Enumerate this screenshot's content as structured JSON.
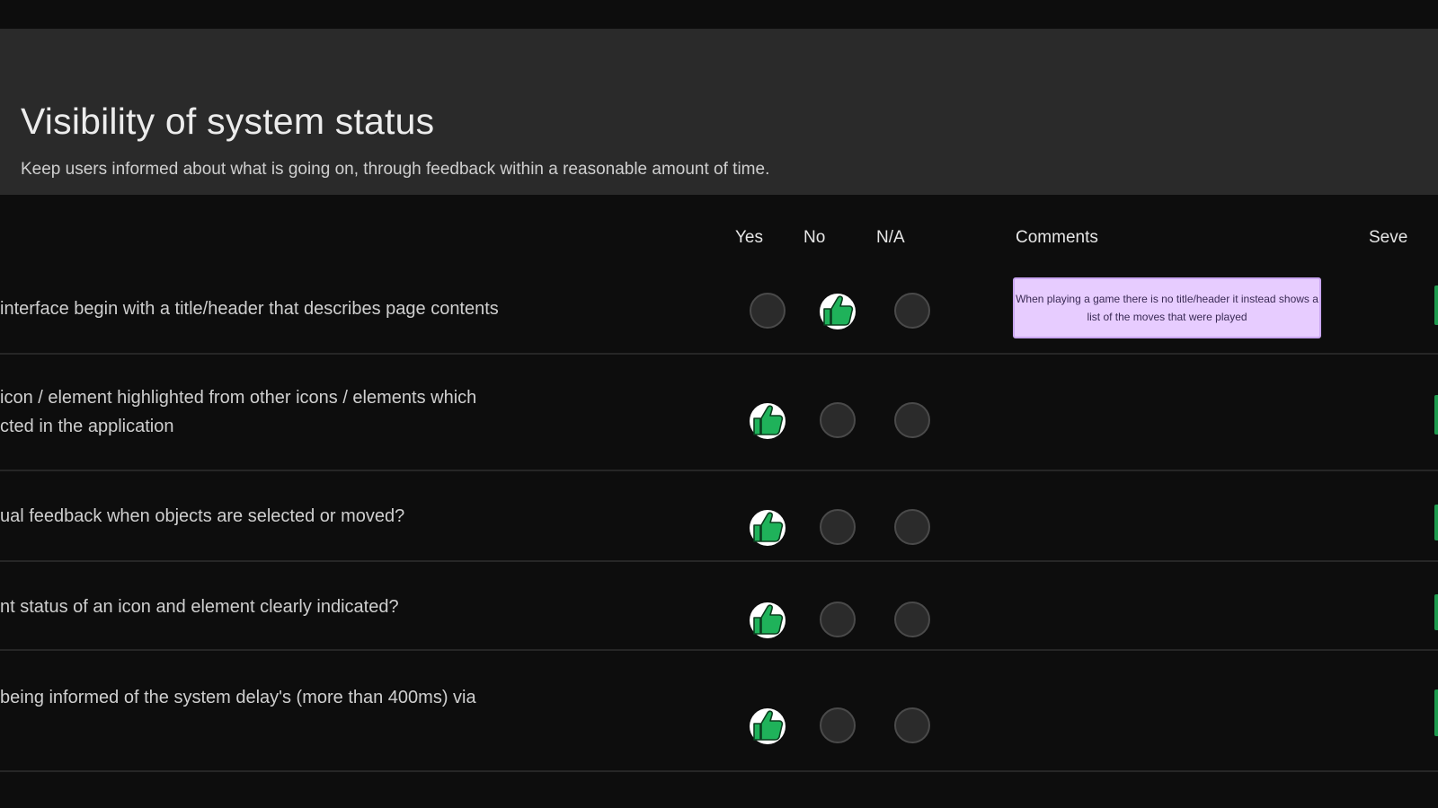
{
  "section": {
    "title": "Visibility of system status",
    "subtitle": "Keep users informed about what is going on, through feedback within a reasonable amount of time."
  },
  "columns": {
    "yes": "Yes",
    "no": "No",
    "na": "N/A",
    "comments": "Comments",
    "severity": "Seve"
  },
  "rows": [
    {
      "lines": [
        "interface begin with a title/header that describes page contents"
      ],
      "answer": "no",
      "comment": "When playing a game there is no title/header it instead shows a list of the moves that were played"
    },
    {
      "lines": [
        "icon / element highlighted from other icons / elements which",
        "cted in the application"
      ],
      "answer": "yes",
      "comment": ""
    },
    {
      "lines": [
        "ual feedback when objects are selected or moved?"
      ],
      "answer": "yes",
      "comment": ""
    },
    {
      "lines": [
        "nt status of an icon and element clearly indicated?"
      ],
      "answer": "yes",
      "comment": ""
    },
    {
      "lines": [
        "being informed of the system delay's (more than 400ms) via"
      ],
      "answer": "yes",
      "comment": ""
    }
  ],
  "colors": {
    "thumb_green": "#1fb25a",
    "comment_bg": "#e7ccff",
    "header_bg": "#2a2a2a",
    "page_bg": "#0d0d0d"
  },
  "icons": {
    "selected": "thumbs-up-icon",
    "unselected": "empty-radio-circle"
  }
}
